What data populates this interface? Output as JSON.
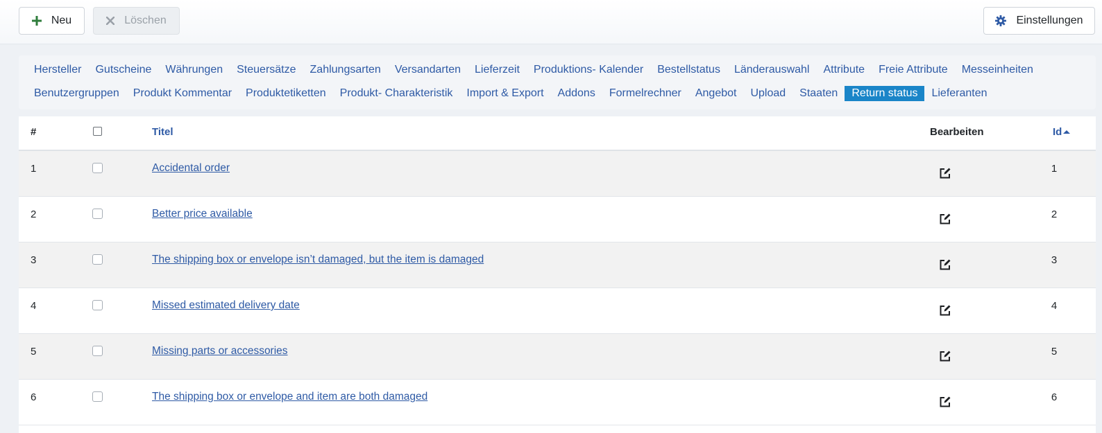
{
  "toolbar": {
    "new_label": "Neu",
    "delete_label": "Löschen",
    "settings_label": "Einstellungen"
  },
  "submenu": {
    "row1": [
      "Hersteller",
      "Gutscheine",
      "Währungen",
      "Steuersätze",
      "Zahlungsarten",
      "Versandarten",
      "Lieferzeit",
      "Produktions- Kalender",
      "Bestellstatus",
      "Länderauswahl",
      "Attribute",
      "Freie Attribute",
      "Messeinheiten"
    ],
    "row2": [
      "Benutzergruppen",
      "Produkt Kommentar",
      "Produktetiketten",
      "Produkt- Charakteristik",
      "Import & Export",
      "Addons",
      "Formelrechner",
      "Angebot",
      "Upload",
      "Staaten",
      "Return status",
      "Lieferanten"
    ],
    "active": "Return status"
  },
  "table": {
    "headers": {
      "num": "#",
      "title": "Titel",
      "edit": "Bearbeiten",
      "id": "Id"
    },
    "rows": [
      {
        "num": "1",
        "title": "Accidental order",
        "id": "1"
      },
      {
        "num": "2",
        "title": "Better price available",
        "id": "2"
      },
      {
        "num": "3",
        "title": "The shipping box or envelope isn’t damaged, but the item is damaged",
        "id": "3"
      },
      {
        "num": "4",
        "title": "Missed estimated delivery date",
        "id": "4"
      },
      {
        "num": "5",
        "title": "Missing parts or accessories",
        "id": "5"
      },
      {
        "num": "6",
        "title": "The shipping box or envelope and item are both damaged",
        "id": "6"
      }
    ]
  },
  "icons": {
    "new": "plus-icon",
    "delete": "x-icon",
    "settings": "gear-icon",
    "edit": "edit-icon",
    "sort": "sort-asc-icon"
  },
  "colors": {
    "link": "#2e5aa5",
    "active_tab": "#1a85c8",
    "new_icon": "#2f7d3c",
    "settings_icon": "#2e5aa5"
  }
}
